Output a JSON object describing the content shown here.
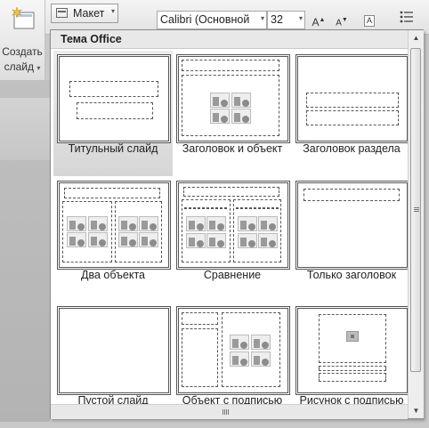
{
  "ribbon": {
    "create_slide_label_1": "Создать",
    "create_slide_label_2": "слайд",
    "create_slide_dropdown": "▾",
    "layout_button_label": "Макет",
    "layout_dropdown": "▾",
    "font_name": "Calibri (Основной",
    "font_size": "32",
    "grow_font": "A",
    "shrink_font": "A",
    "clear_format": "A",
    "list_icon": "list-icon"
  },
  "menu": {
    "title": "Тема Office",
    "layouts": [
      {
        "name": "Титульный слайд",
        "selected": true
      },
      {
        "name": "Заголовок и объект",
        "selected": false
      },
      {
        "name": "Заголовок раздела",
        "selected": false
      },
      {
        "name": "Два объекта",
        "selected": false
      },
      {
        "name": "Сравнение",
        "selected": false
      },
      {
        "name": "Только заголовок",
        "selected": false
      },
      {
        "name": "Пустой слайд",
        "selected": false
      },
      {
        "name": "Объект с подписью",
        "selected": false
      },
      {
        "name": "Рисунок с подписью",
        "selected": false
      }
    ]
  },
  "scrollbar": {
    "up": "▲",
    "down": "▼"
  }
}
